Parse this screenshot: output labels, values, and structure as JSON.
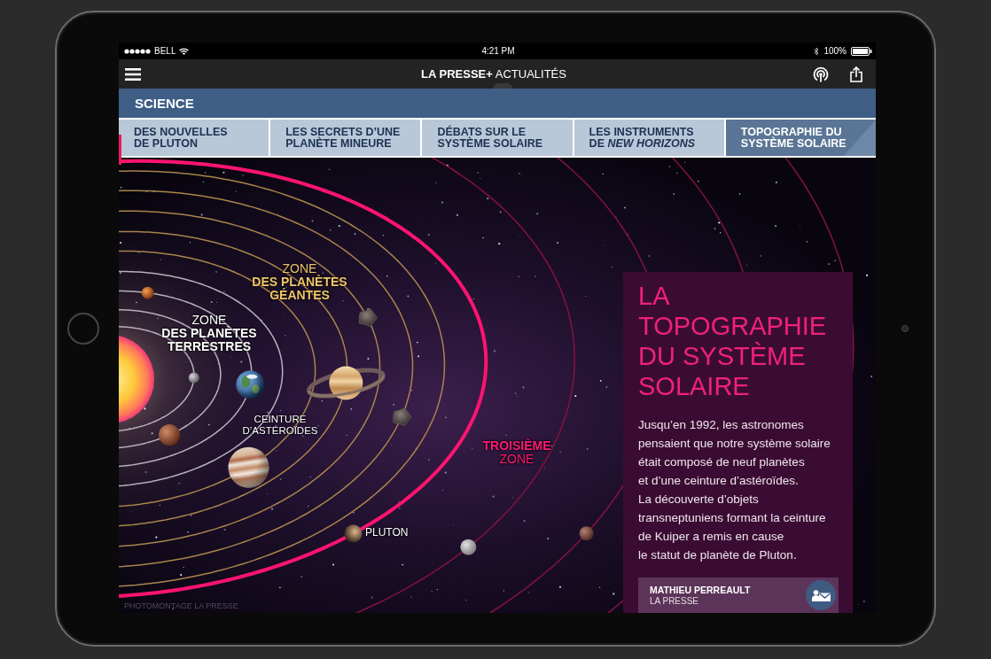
{
  "status_bar": {
    "carrier": "BELL",
    "time": "4:21 PM",
    "battery": "100%"
  },
  "app_bar": {
    "title": "**LA PRESSE+** ACTUALITÉS"
  },
  "section": {
    "title": "SCIENCE"
  },
  "tabs": [
    {
      "label": "DES NOUVELLES\nDE PLUTON",
      "selected": false
    },
    {
      "label": "LES SECRETS D’UNE\nPLANÈTE MINEURE",
      "selected": false
    },
    {
      "label": "DÉBATS SUR LE\nSYSTÈME SOLAIRE",
      "selected": false
    },
    {
      "label": "LES INSTRUMENTS\nDE *NEW HORIZONS*",
      "selected": false
    },
    {
      "label": "TOPOGRAPHIE DU\nSYSTÈME SOLAIRE",
      "selected": true
    }
  ],
  "illustration": {
    "labels": [
      {
        "kind": "giant-zone",
        "text": "ZONE\n**DES PLANÈTES**\n**GÉANTES**"
      },
      {
        "kind": "terrestrial-zone",
        "text": "ZONE\n**DES PLANÈTES**\n**TERRESTRES**"
      },
      {
        "kind": "asteroid-belt",
        "text": "CEINTURE\nD’ASTÉROÏDES"
      },
      {
        "kind": "third-zone",
        "text": "**TROISIÈME**\nZONE"
      },
      {
        "kind": "dwarf-planet",
        "text": "PLUTON"
      }
    ],
    "credit": "PHOTOMONTAGE LA PRESSE"
  },
  "article": {
    "title": "LA TOPOGRAPHIE DU SYSTÈME SOLAIRE",
    "body": "Jusqu’en 1992, les astronomes\npensaient que notre système solaire\nétait composé de neuf planètes\net d’une ceinture d’astéroïdes.\nLa découverte d’objets\ntransneptuniens formant la ceinture\nde Kuiper a remis en cause\nle statut de planète de Pluton.",
    "author": {
      "name": "MATHIEU PERREAULT",
      "outlet": "LA PRESSE"
    }
  }
}
